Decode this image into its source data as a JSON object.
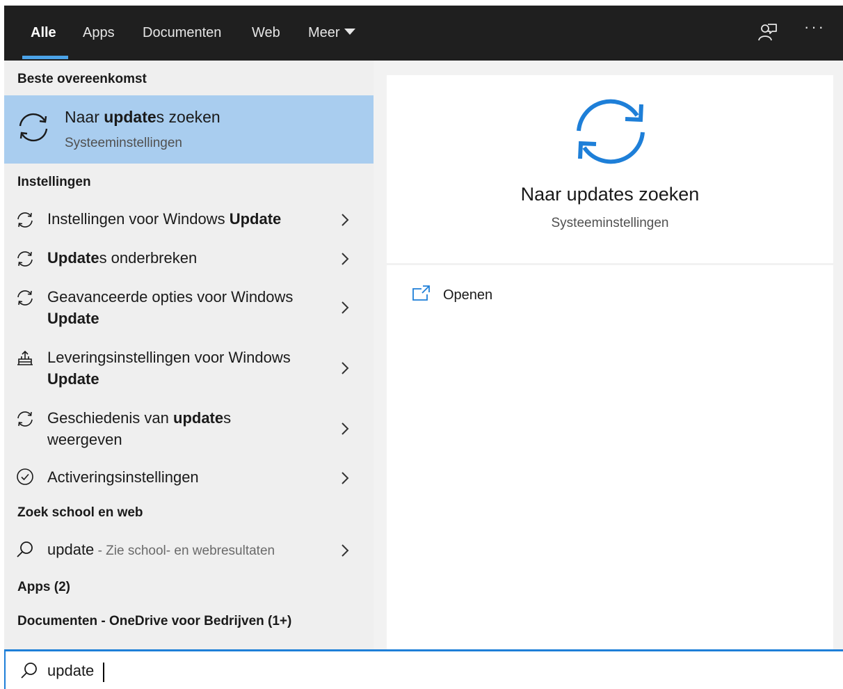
{
  "tabs": [
    {
      "label": "Alle"
    },
    {
      "label": "Apps"
    },
    {
      "label": "Documenten"
    },
    {
      "label": "Web"
    },
    {
      "label": "Meer"
    }
  ],
  "header_icons": {
    "feedback": "feedback-person-icon",
    "more": "···"
  },
  "left": {
    "best_match_header": "Beste overeenkomst",
    "best_match": {
      "title_pre": "Naar ",
      "title_bold": "update",
      "title_post": "s zoeken",
      "subtitle": "Systeeminstellingen",
      "icon": "sync-icon"
    },
    "settings_header": "Instellingen",
    "settings_items": [
      {
        "pre": "Instellingen voor Windows ",
        "bold": "Update",
        "post": "",
        "icon": "sync-icon"
      },
      {
        "pre": "",
        "bold": "Update",
        "post": "s onderbreken",
        "icon": "sync-icon"
      },
      {
        "pre": "Geavanceerde opties voor Windows ",
        "bold": "Update",
        "post": "",
        "icon": "sync-icon"
      },
      {
        "pre": "Leveringsinstellingen voor Windows ",
        "bold": "Update",
        "post": "",
        "icon": "delivery-icon"
      },
      {
        "pre": "Geschiedenis van ",
        "bold": "update",
        "post": "s weergeven",
        "icon": "sync-icon"
      },
      {
        "pre": "Activeringsinstellingen",
        "bold": "",
        "post": "",
        "icon": "check-circle-icon"
      }
    ],
    "web_header": "Zoek school en web",
    "web_item": {
      "query": "update",
      "hint": " - Zie school- en webresultaten"
    },
    "apps_header": "Apps (2)",
    "docs_header": "Documenten - OneDrive voor Bedrijven (1+)"
  },
  "right": {
    "title": "Naar updates zoeken",
    "subtitle": "Systeeminstellingen",
    "open_label": "Openen"
  },
  "search": {
    "value": "update"
  },
  "colors": {
    "accent": "#1e7fd8",
    "selected": "#a9cdef",
    "topbar": "#1f1f1f"
  }
}
